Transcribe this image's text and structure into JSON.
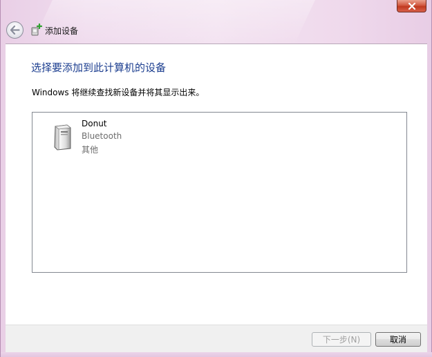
{
  "window": {
    "faded_title": "",
    "nav_title": "添加设备"
  },
  "content": {
    "main_instruction": "选择要添加到此计算机的设备",
    "sub_text": "Windows 将继续查找新设备并将其显示出来。"
  },
  "devices": [
    {
      "name": "Donut",
      "type": "Bluetooth",
      "category": "其他",
      "icon": "generic-device-icon"
    }
  ],
  "buttons": {
    "next_label": "下一步(N)",
    "next_enabled": false,
    "cancel_label": "取消"
  },
  "icons": {
    "close": "close-icon",
    "back": "back-arrow-icon",
    "nav": "add-device-icon"
  },
  "colors": {
    "instruction": "#1b3d8f",
    "close_button": "#c0391f",
    "disabled_text": "#a0a0a0"
  }
}
